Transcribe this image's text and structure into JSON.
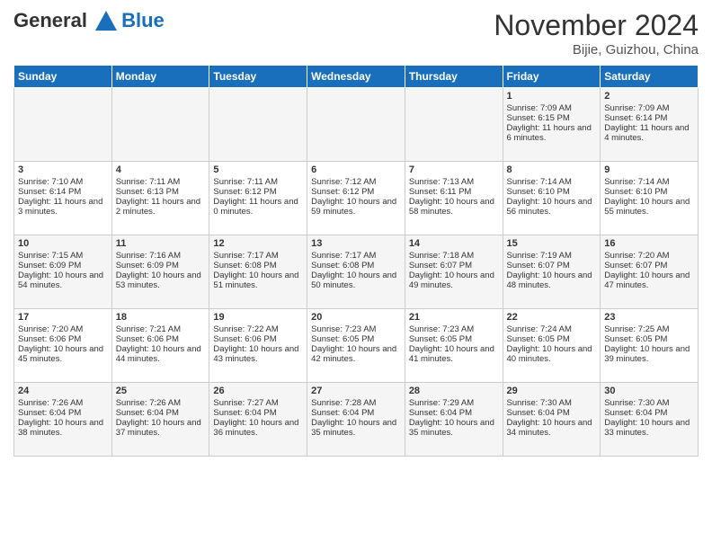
{
  "logo": {
    "line1": "General",
    "line2": "Blue"
  },
  "title": "November 2024",
  "subtitle": "Bijie, Guizhou, China",
  "days_of_week": [
    "Sunday",
    "Monday",
    "Tuesday",
    "Wednesday",
    "Thursday",
    "Friday",
    "Saturday"
  ],
  "weeks": [
    [
      {
        "day": "",
        "info": ""
      },
      {
        "day": "",
        "info": ""
      },
      {
        "day": "",
        "info": ""
      },
      {
        "day": "",
        "info": ""
      },
      {
        "day": "",
        "info": ""
      },
      {
        "day": "1",
        "info": "Sunrise: 7:09 AM\nSunset: 6:15 PM\nDaylight: 11 hours and 6 minutes."
      },
      {
        "day": "2",
        "info": "Sunrise: 7:09 AM\nSunset: 6:14 PM\nDaylight: 11 hours and 4 minutes."
      }
    ],
    [
      {
        "day": "3",
        "info": "Sunrise: 7:10 AM\nSunset: 6:14 PM\nDaylight: 11 hours and 3 minutes."
      },
      {
        "day": "4",
        "info": "Sunrise: 7:11 AM\nSunset: 6:13 PM\nDaylight: 11 hours and 2 minutes."
      },
      {
        "day": "5",
        "info": "Sunrise: 7:11 AM\nSunset: 6:12 PM\nDaylight: 11 hours and 0 minutes."
      },
      {
        "day": "6",
        "info": "Sunrise: 7:12 AM\nSunset: 6:12 PM\nDaylight: 10 hours and 59 minutes."
      },
      {
        "day": "7",
        "info": "Sunrise: 7:13 AM\nSunset: 6:11 PM\nDaylight: 10 hours and 58 minutes."
      },
      {
        "day": "8",
        "info": "Sunrise: 7:14 AM\nSunset: 6:10 PM\nDaylight: 10 hours and 56 minutes."
      },
      {
        "day": "9",
        "info": "Sunrise: 7:14 AM\nSunset: 6:10 PM\nDaylight: 10 hours and 55 minutes."
      }
    ],
    [
      {
        "day": "10",
        "info": "Sunrise: 7:15 AM\nSunset: 6:09 PM\nDaylight: 10 hours and 54 minutes."
      },
      {
        "day": "11",
        "info": "Sunrise: 7:16 AM\nSunset: 6:09 PM\nDaylight: 10 hours and 53 minutes."
      },
      {
        "day": "12",
        "info": "Sunrise: 7:17 AM\nSunset: 6:08 PM\nDaylight: 10 hours and 51 minutes."
      },
      {
        "day": "13",
        "info": "Sunrise: 7:17 AM\nSunset: 6:08 PM\nDaylight: 10 hours and 50 minutes."
      },
      {
        "day": "14",
        "info": "Sunrise: 7:18 AM\nSunset: 6:07 PM\nDaylight: 10 hours and 49 minutes."
      },
      {
        "day": "15",
        "info": "Sunrise: 7:19 AM\nSunset: 6:07 PM\nDaylight: 10 hours and 48 minutes."
      },
      {
        "day": "16",
        "info": "Sunrise: 7:20 AM\nSunset: 6:07 PM\nDaylight: 10 hours and 47 minutes."
      }
    ],
    [
      {
        "day": "17",
        "info": "Sunrise: 7:20 AM\nSunset: 6:06 PM\nDaylight: 10 hours and 45 minutes."
      },
      {
        "day": "18",
        "info": "Sunrise: 7:21 AM\nSunset: 6:06 PM\nDaylight: 10 hours and 44 minutes."
      },
      {
        "day": "19",
        "info": "Sunrise: 7:22 AM\nSunset: 6:06 PM\nDaylight: 10 hours and 43 minutes."
      },
      {
        "day": "20",
        "info": "Sunrise: 7:23 AM\nSunset: 6:05 PM\nDaylight: 10 hours and 42 minutes."
      },
      {
        "day": "21",
        "info": "Sunrise: 7:23 AM\nSunset: 6:05 PM\nDaylight: 10 hours and 41 minutes."
      },
      {
        "day": "22",
        "info": "Sunrise: 7:24 AM\nSunset: 6:05 PM\nDaylight: 10 hours and 40 minutes."
      },
      {
        "day": "23",
        "info": "Sunrise: 7:25 AM\nSunset: 6:05 PM\nDaylight: 10 hours and 39 minutes."
      }
    ],
    [
      {
        "day": "24",
        "info": "Sunrise: 7:26 AM\nSunset: 6:04 PM\nDaylight: 10 hours and 38 minutes."
      },
      {
        "day": "25",
        "info": "Sunrise: 7:26 AM\nSunset: 6:04 PM\nDaylight: 10 hours and 37 minutes."
      },
      {
        "day": "26",
        "info": "Sunrise: 7:27 AM\nSunset: 6:04 PM\nDaylight: 10 hours and 36 minutes."
      },
      {
        "day": "27",
        "info": "Sunrise: 7:28 AM\nSunset: 6:04 PM\nDaylight: 10 hours and 35 minutes."
      },
      {
        "day": "28",
        "info": "Sunrise: 7:29 AM\nSunset: 6:04 PM\nDaylight: 10 hours and 35 minutes."
      },
      {
        "day": "29",
        "info": "Sunrise: 7:30 AM\nSunset: 6:04 PM\nDaylight: 10 hours and 34 minutes."
      },
      {
        "day": "30",
        "info": "Sunrise: 7:30 AM\nSunset: 6:04 PM\nDaylight: 10 hours and 33 minutes."
      }
    ]
  ]
}
